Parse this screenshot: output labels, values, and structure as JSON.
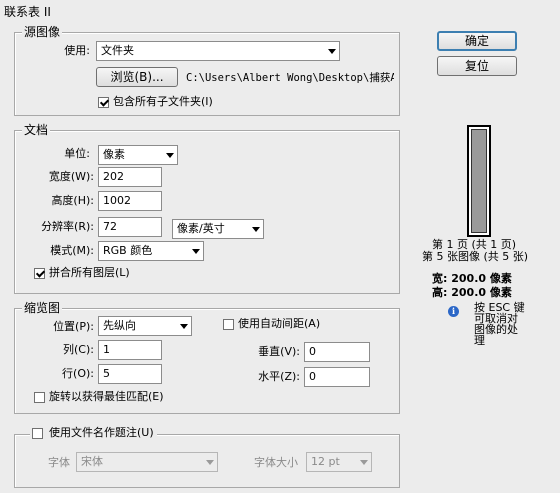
{
  "window": {
    "title": "联系表 II"
  },
  "buttons": {
    "ok": "确定",
    "reset": "复位"
  },
  "source": {
    "legend": "源图像",
    "use_label": "使用:",
    "use_value": "文件夹",
    "browse_label": "浏览(B)...",
    "path": "C:\\Users\\Albert Wong\\Desktop\\捕获A\\",
    "include_subfolders": {
      "label": "包含所有子文件夹(I)",
      "checked": true
    }
  },
  "document": {
    "legend": "文档",
    "unit_label": "单位:",
    "unit_value": "像素",
    "width_label": "宽度(W):",
    "width_value": "202",
    "height_label": "高度(H):",
    "height_value": "1002",
    "resolution_label": "分辨率(R):",
    "resolution_value": "72",
    "resolution_unit": "像素/英寸",
    "mode_label": "模式(M):",
    "mode_value": "RGB 颜色",
    "flatten": {
      "label": "拼合所有图层(L)",
      "checked": true
    }
  },
  "thumbnails": {
    "legend": "缩览图",
    "place_label": "位置(P):",
    "place_value": "先纵向",
    "columns_label": "列(C):",
    "columns_value": "1",
    "rows_label": "行(O):",
    "rows_value": "5",
    "auto_spacing": {
      "label": "使用自动间距(A)",
      "checked": false
    },
    "vertical_label": "垂直(V):",
    "vertical_value": "0",
    "horizontal_label": "水平(Z):",
    "horizontal_value": "0",
    "rotate": {
      "label": "旋转以获得最佳匹配(E)",
      "checked": false
    }
  },
  "caption": {
    "use_filename": {
      "label": "使用文件名作题注(U)",
      "checked": false
    },
    "font_label": "字体",
    "font_value": "宋体",
    "size_label": "字体大小",
    "size_value": "12 pt"
  },
  "preview": {
    "page_line": "第 1 页 (共 1 页)",
    "image_line": "第 5 张图像 (共 5 张)",
    "width_line": "宽: 200.0 像素",
    "height_line": "高: 200.0 像素",
    "esc_hint": "按 ESC 键可取消对图像的处理"
  }
}
